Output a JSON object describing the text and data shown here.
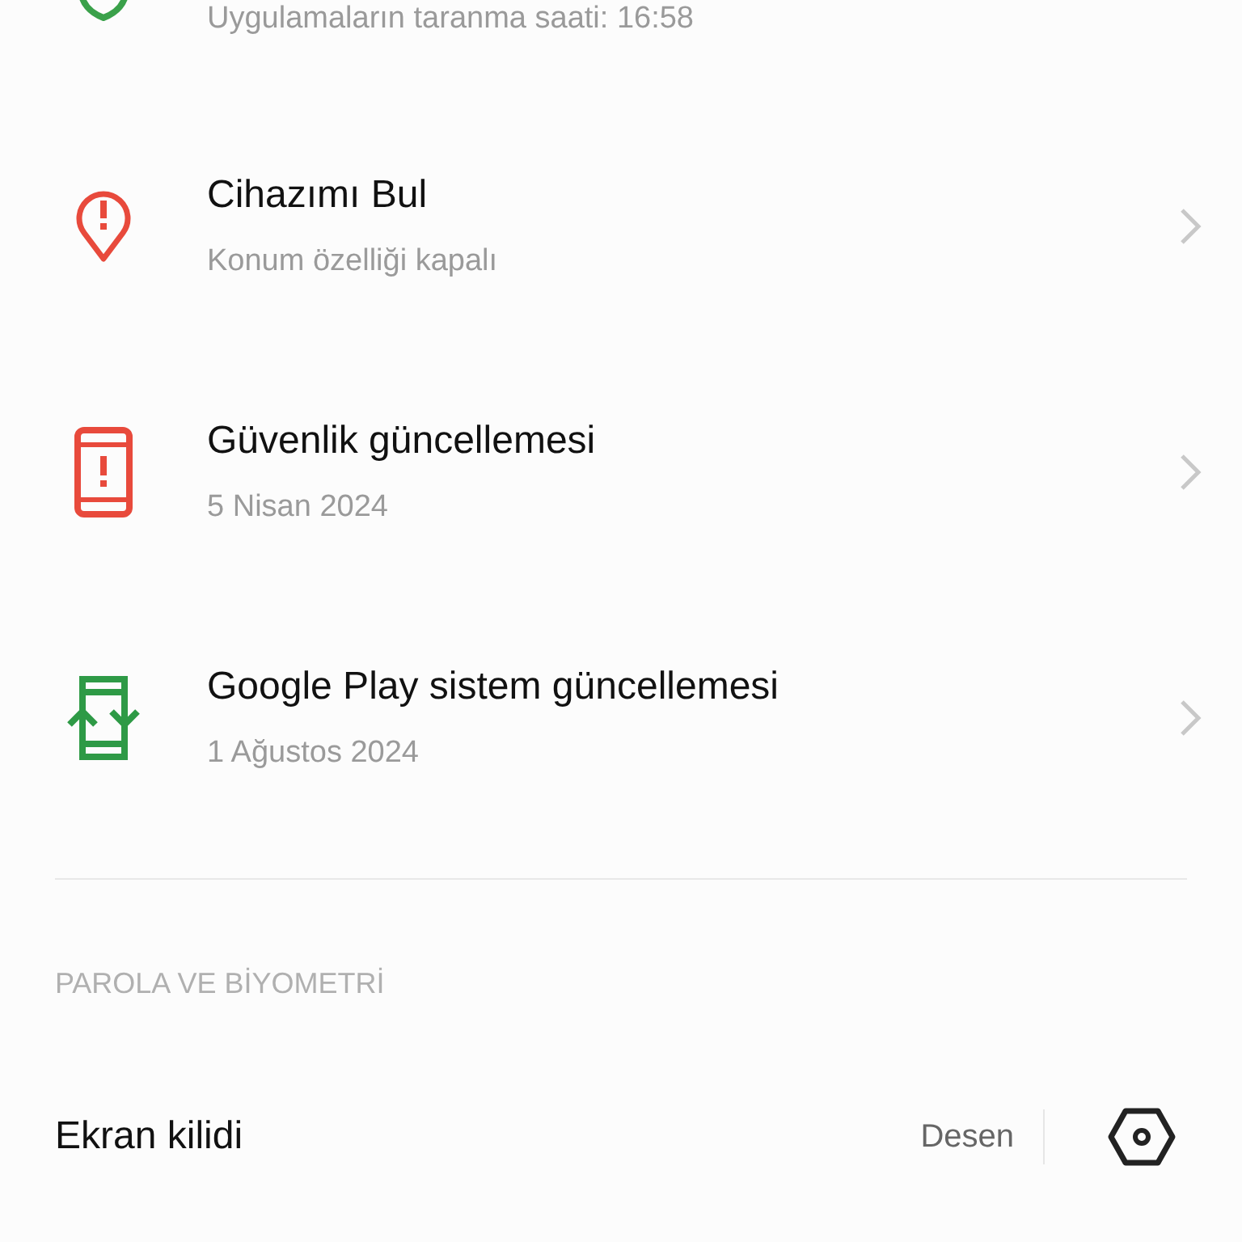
{
  "security_items": [
    {
      "kind": "shield",
      "subtitle": "Uygulamaların taranma saati: 16:58"
    },
    {
      "kind": "pin",
      "title": "Cihazımı Bul",
      "subtitle": "Konum özelliği kapalı"
    },
    {
      "kind": "phone",
      "title": "Güvenlik güncellemesi",
      "subtitle": "5 Nisan 2024"
    },
    {
      "kind": "sync",
      "title": "Google Play sistem güncellemesi",
      "subtitle": "1 Ağustos 2024"
    }
  ],
  "section": {
    "header": "PAROLA VE BİYOMETRİ",
    "items": [
      {
        "label": "Ekran kilidi",
        "value": "Desen"
      }
    ]
  }
}
